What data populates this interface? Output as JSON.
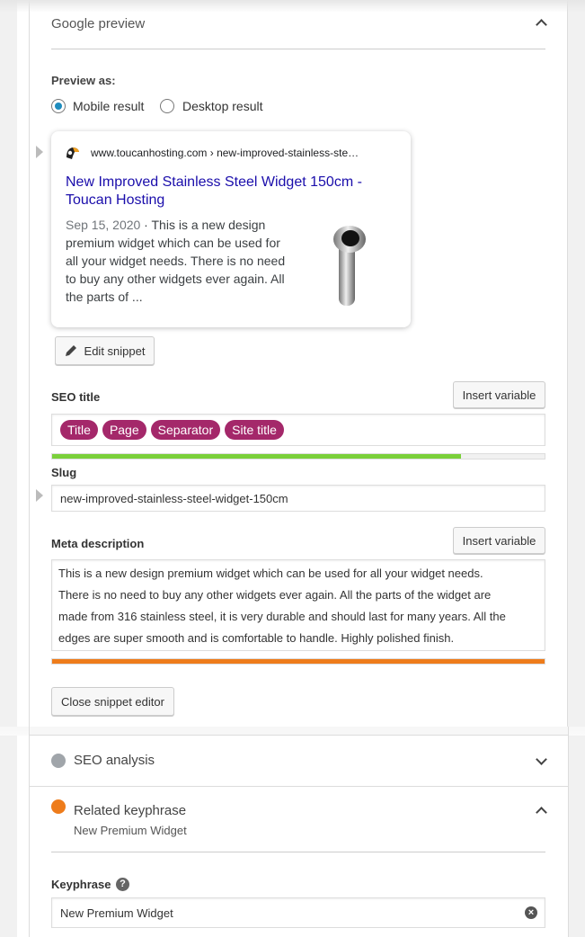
{
  "google_preview": {
    "title": "Google preview",
    "preview_as_label": "Preview as:",
    "options": [
      {
        "label": "Mobile result",
        "selected": true
      },
      {
        "label": "Desktop result",
        "selected": false
      }
    ],
    "result": {
      "favicon": "toucan-icon",
      "url": "www.toucanhosting.com › new-improved-stainless-ste…",
      "title_line1": "New Improved Stainless Steel Widget 150cm -",
      "title_line2": "Toucan Hosting",
      "date": "Sep 15, 2020",
      "separator": " · ",
      "desc_lines": [
        "This is a new design",
        "premium widget which can be used for",
        "all your widget needs. There is no need",
        "to buy any other widgets ever again. All",
        "the parts of ..."
      ],
      "title_color": "#1a0dab"
    },
    "edit_snippet_label": "Edit snippet"
  },
  "snippet_editor": {
    "seo_title": {
      "label": "SEO title",
      "insert_variable_label": "Insert variable",
      "variables": [
        "Title",
        "Page",
        "Separator",
        "Site title"
      ],
      "progress_percent": 83,
      "progress_color": "#7ad03a"
    },
    "slug": {
      "label": "Slug",
      "value": "new-improved-stainless-steel-widget-150cm"
    },
    "meta_description": {
      "label": "Meta description",
      "insert_variable_label": "Insert variable",
      "lines": [
        "This is a new design premium widget which can be used for all your widget needs.",
        "There is no need to buy any other widgets ever again. All the parts of the widget are",
        "made from 316 stainless steel, it is very durable and should last for many years. All the",
        "edges are super smooth and is comfortable to handle. Highly polished finish."
      ],
      "progress_percent": 100,
      "progress_color": "#ee7c1b"
    },
    "close_label": "Close snippet editor"
  },
  "seo_analysis": {
    "title": "SEO analysis",
    "status_color": "#a0a5aa"
  },
  "related_keyphrase": {
    "title": "Related keyphrase",
    "subtitle": "New Premium Widget",
    "status_color": "#ee7c1b",
    "keyphrase_label": "Keyphrase",
    "keyphrase_value": "New Premium Widget"
  }
}
